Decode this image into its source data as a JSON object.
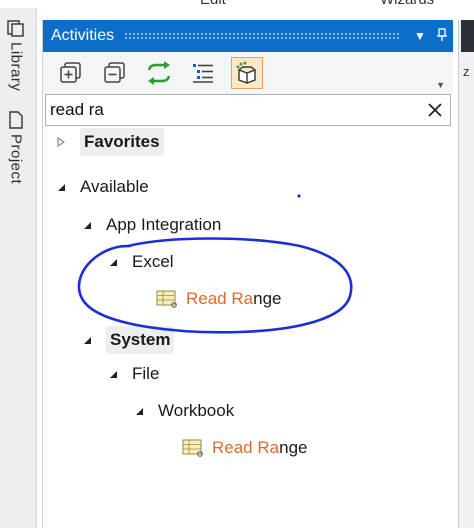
{
  "window": {
    "top_labels": [
      "Edit",
      "Wizards"
    ]
  },
  "side_tabs": [
    {
      "label": "Library",
      "icon": "library-icon"
    },
    {
      "label": "Project",
      "icon": "project-icon"
    }
  ],
  "panel": {
    "title": "Activities",
    "title_buttons": [
      "dropdown-icon",
      "pin-icon"
    ],
    "toolbar": [
      "expand-all-icon",
      "collapse-all-icon",
      "refresh-icon",
      "list-view-icon",
      "available-packages-icon"
    ],
    "search": {
      "value": "read ra",
      "placeholder": ""
    }
  },
  "tree": {
    "favorites": "Favorites",
    "available": "Available",
    "app_integration": "App Integration",
    "excel": "Excel",
    "activity1": {
      "match": "Read Ra",
      "rest": "nge"
    },
    "system": "System",
    "file": "File",
    "workbook": "Workbook",
    "activity2": {
      "match": "Read Ra",
      "rest": "nge"
    }
  },
  "colors": {
    "accent": "#0b6ec8",
    "match_highlight": "#e06a2c",
    "annotation": "#1a2fd6"
  },
  "right_edge_label": "z"
}
